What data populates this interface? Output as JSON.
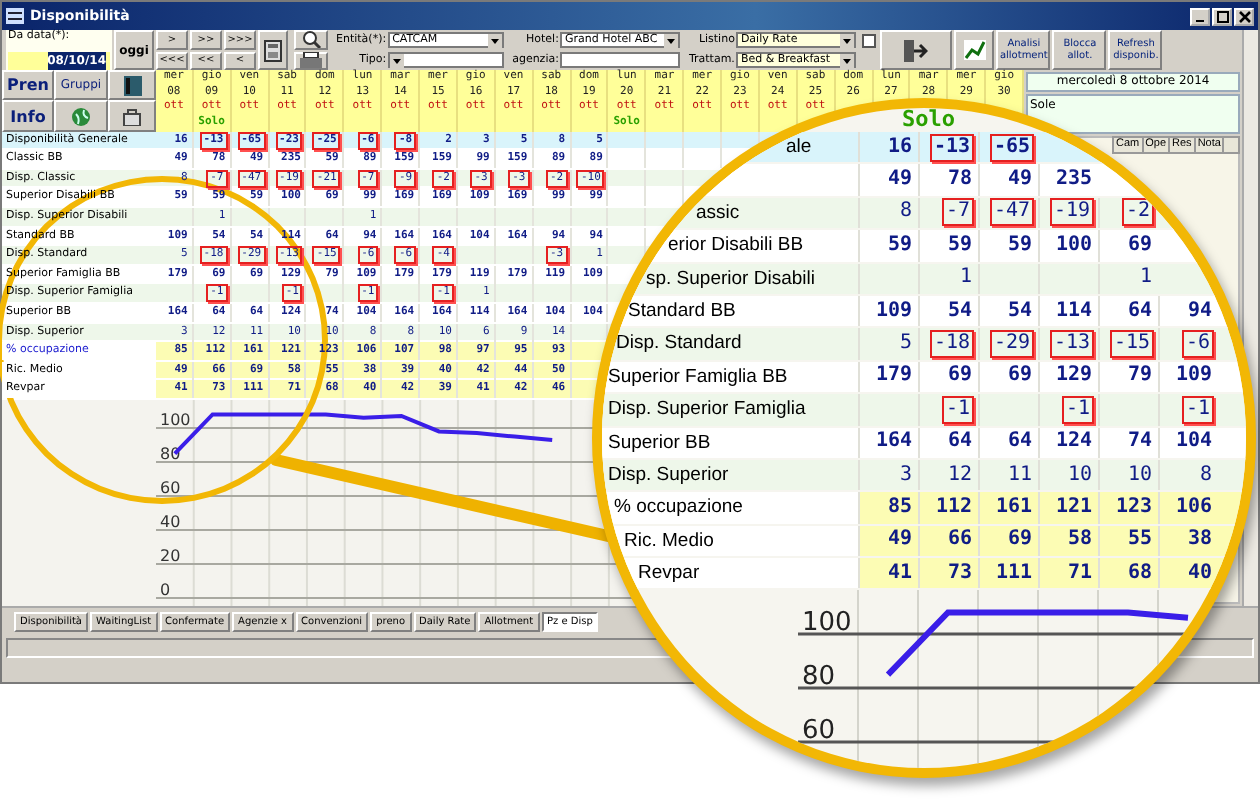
{
  "window": {
    "title": "Disponibilità"
  },
  "toolbar": {
    "date_label": "Da data(*):",
    "date_value": "08/10/14",
    "today_button": "oggi",
    "nav_forward": [
      ">",
      ">>",
      ">>>"
    ],
    "nav_back": [
      "<<<",
      "<<",
      "<"
    ],
    "entity": {
      "label": "Entità(*):",
      "value": "CATCAM"
    },
    "type": {
      "label": "Tipo:"
    },
    "hotel": {
      "label": "Hotel:",
      "value": "Grand Hotel ABC"
    },
    "agency": {
      "label": "agenzia:"
    },
    "price_list": {
      "label": "Listino",
      "value": "Daily Rate"
    },
    "board": {
      "label": "Trattam.",
      "value": "Bed & Breakfast"
    },
    "option_checked": false,
    "buttons": [
      "Analisi allotment",
      "Blocca allot.",
      "Refresh disponib."
    ]
  },
  "side_buttons": [
    {
      "label": "Pren"
    },
    {
      "label": "Gruppi"
    },
    {
      "label": "Info"
    }
  ],
  "dates": [
    {
      "weekday": "mer",
      "day": "08",
      "month": "ott"
    },
    {
      "weekday": "gio",
      "day": "09",
      "month": "ott",
      "note": "Solo"
    },
    {
      "weekday": "ven",
      "day": "10",
      "month": "ott"
    },
    {
      "weekday": "sab",
      "day": "11",
      "month": "ott"
    },
    {
      "weekday": "dom",
      "day": "12",
      "month": "ott"
    },
    {
      "weekday": "lun",
      "day": "13",
      "month": "ott"
    },
    {
      "weekday": "mar",
      "day": "14",
      "month": "ott"
    },
    {
      "weekday": "mer",
      "day": "15",
      "month": "ott"
    },
    {
      "weekday": "gio",
      "day": "16",
      "month": "ott"
    },
    {
      "weekday": "ven",
      "day": "17",
      "month": "ott"
    },
    {
      "weekday": "sab",
      "day": "18",
      "month": "ott"
    },
    {
      "weekday": "dom",
      "day": "19",
      "month": "ott"
    },
    {
      "weekday": "lun",
      "day": "20",
      "month": "ott",
      "note": "Solo"
    },
    {
      "weekday": "mar",
      "day": "21",
      "month": "ott"
    },
    {
      "weekday": "mer",
      "day": "22",
      "month": "ott"
    },
    {
      "weekday": "gio",
      "day": "23",
      "month": "ott"
    },
    {
      "weekday": "ven",
      "day": "24",
      "month": "ott"
    },
    {
      "weekday": "sab",
      "day": "25",
      "month": "ott"
    },
    {
      "weekday": "dom",
      "day": "26"
    },
    {
      "weekday": "lun",
      "day": "27"
    },
    {
      "weekday": "mar",
      "day": "28"
    },
    {
      "weekday": "mer",
      "day": "29"
    },
    {
      "weekday": "gio",
      "day": "30"
    }
  ],
  "rows": [
    {
      "label": "Disponibilità Generale",
      "kind": "total",
      "cells": [
        {
          "value": "16",
          "alert": false
        },
        {
          "value": "-13",
          "alert": true
        },
        {
          "value": "-65",
          "alert": true
        },
        {
          "value": "-23",
          "alert": true
        },
        {
          "value": "-25",
          "alert": true
        },
        {
          "value": "-6",
          "alert": true
        },
        {
          "value": "-8",
          "alert": true
        },
        {
          "value": "2",
          "alert": false
        },
        {
          "value": "3",
          "alert": false
        },
        {
          "value": "5",
          "alert": false
        },
        {
          "value": "8",
          "alert": false
        },
        {
          "value": "5",
          "alert": false
        }
      ]
    },
    {
      "label": "Classic BB",
      "kind": "room",
      "cells": [
        {
          "value": "49",
          "alert": false
        },
        {
          "value": "78",
          "alert": false
        },
        {
          "value": "49",
          "alert": false
        },
        {
          "value": "235",
          "alert": false
        },
        {
          "value": "59",
          "alert": false
        },
        {
          "value": "89",
          "alert": false
        },
        {
          "value": "159",
          "alert": false
        },
        {
          "value": "159",
          "alert": false
        },
        {
          "value": "99",
          "alert": false
        },
        {
          "value": "159",
          "alert": false
        },
        {
          "value": "89",
          "alert": false
        },
        {
          "value": "89",
          "alert": false
        }
      ]
    },
    {
      "label": "Disp.  Classic",
      "kind": "avail",
      "cells": [
        {
          "value": "8",
          "alert": false
        },
        {
          "value": "-7",
          "alert": true
        },
        {
          "value": "-47",
          "alert": true
        },
        {
          "value": "-19",
          "alert": true
        },
        {
          "value": "-21",
          "alert": true
        },
        {
          "value": "-7",
          "alert": true
        },
        {
          "value": "-9",
          "alert": true
        },
        {
          "value": "-2",
          "alert": true
        },
        {
          "value": "-3",
          "alert": true
        },
        {
          "value": "-3",
          "alert": true
        },
        {
          "value": "-2",
          "alert": true
        },
        {
          "value": "-10",
          "alert": true
        }
      ]
    },
    {
      "label": "Superior Disabili BB",
      "kind": "room",
      "cells": [
        {
          "value": "59",
          "alert": false
        },
        {
          "value": "59",
          "alert": false
        },
        {
          "value": "59",
          "alert": false
        },
        {
          "value": "100",
          "alert": false
        },
        {
          "value": "69",
          "alert": false
        },
        {
          "value": "99",
          "alert": false
        },
        {
          "value": "169",
          "alert": false
        },
        {
          "value": "169",
          "alert": false
        },
        {
          "value": "109",
          "alert": false
        },
        {
          "value": "169",
          "alert": false
        },
        {
          "value": "99",
          "alert": false
        },
        {
          "value": "99",
          "alert": false
        }
      ]
    },
    {
      "label": "Disp.  Superior Disabili",
      "kind": "avail",
      "cells": [
        {},
        {
          "value": "1",
          "alert": false
        },
        {},
        {},
        {},
        {
          "value": "1",
          "alert": false
        }
      ]
    },
    {
      "label": "Standard BB",
      "kind": "room",
      "cells": [
        {
          "value": "109",
          "alert": false
        },
        {
          "value": "54",
          "alert": false
        },
        {
          "value": "54",
          "alert": false
        },
        {
          "value": "114",
          "alert": false
        },
        {
          "value": "64",
          "alert": false
        },
        {
          "value": "94",
          "alert": false
        },
        {
          "value": "164",
          "alert": false
        },
        {
          "value": "164",
          "alert": false
        },
        {
          "value": "104",
          "alert": false
        },
        {
          "value": "164",
          "alert": false
        },
        {
          "value": "94",
          "alert": false
        },
        {
          "value": "94",
          "alert": false
        }
      ]
    },
    {
      "label": "Disp.  Standard",
      "kind": "avail",
      "cells": [
        {
          "value": "5",
          "alert": false
        },
        {
          "value": "-18",
          "alert": true
        },
        {
          "value": "-29",
          "alert": true
        },
        {
          "value": "-13",
          "alert": true
        },
        {
          "value": "-15",
          "alert": true
        },
        {
          "value": "-6",
          "alert": true
        },
        {
          "value": "-6",
          "alert": true
        },
        {
          "value": "-4",
          "alert": true
        },
        {},
        {},
        {
          "value": "-3",
          "alert": true
        },
        {
          "value": "1",
          "alert": false
        }
      ]
    },
    {
      "label": "Superior Famiglia BB",
      "kind": "room",
      "cells": [
        {
          "value": "179",
          "alert": false
        },
        {
          "value": "69",
          "alert": false
        },
        {
          "value": "69",
          "alert": false
        },
        {
          "value": "129",
          "alert": false
        },
        {
          "value": "79",
          "alert": false
        },
        {
          "value": "109",
          "alert": false
        },
        {
          "value": "179",
          "alert": false
        },
        {
          "value": "179",
          "alert": false
        },
        {
          "value": "119",
          "alert": false
        },
        {
          "value": "179",
          "alert": false
        },
        {
          "value": "119",
          "alert": false
        },
        {
          "value": "109",
          "alert": false
        }
      ]
    },
    {
      "label": "Disp.  Superior Famiglia",
      "kind": "avail",
      "cells": [
        {},
        {
          "value": "-1",
          "alert": true
        },
        {},
        {
          "value": "-1",
          "alert": true
        },
        {},
        {
          "value": "-1",
          "alert": true
        },
        {},
        {
          "value": "-1",
          "alert": true
        },
        {
          "value": "1",
          "alert": false
        }
      ]
    },
    {
      "label": "Superior BB",
      "kind": "room",
      "cells": [
        {
          "value": "164",
          "alert": false
        },
        {
          "value": "64",
          "alert": false
        },
        {
          "value": "64",
          "alert": false
        },
        {
          "value": "124",
          "alert": false
        },
        {
          "value": "74",
          "alert": false
        },
        {
          "value": "104",
          "alert": false
        },
        {
          "value": "164",
          "alert": false
        },
        {
          "value": "164",
          "alert": false
        },
        {
          "value": "114",
          "alert": false
        },
        {
          "value": "164",
          "alert": false
        },
        {
          "value": "104",
          "alert": false
        },
        {
          "value": "104",
          "alert": false
        }
      ]
    },
    {
      "label": "Disp.  Superior",
      "kind": "avail",
      "cells": [
        {
          "value": "3",
          "alert": false
        },
        {
          "value": "12",
          "alert": false
        },
        {
          "value": "11",
          "alert": false
        },
        {
          "value": "10",
          "alert": false
        },
        {
          "value": "10",
          "alert": false
        },
        {
          "value": "8",
          "alert": false
        },
        {
          "value": "8",
          "alert": false
        },
        {
          "value": "10",
          "alert": false
        },
        {
          "value": "6",
          "alert": false
        },
        {
          "value": "9",
          "alert": false
        },
        {
          "value": "14",
          "alert": false
        }
      ]
    },
    {
      "label": "% occupazione",
      "kind": "percent",
      "cells": [
        {
          "value": "85",
          "alert": false
        },
        {
          "value": "112",
          "alert": false
        },
        {
          "value": "161",
          "alert": false
        },
        {
          "value": "121",
          "alert": false
        },
        {
          "value": "123",
          "alert": false
        },
        {
          "value": "106",
          "alert": false
        },
        {
          "value": "107",
          "alert": false
        },
        {
          "value": "98",
          "alert": false
        },
        {
          "value": "97",
          "alert": false
        },
        {
          "value": "95",
          "alert": false
        },
        {
          "value": "93",
          "alert": false
        }
      ]
    },
    {
      "label": "Ric. Medio",
      "kind": "stat",
      "cells": [
        {
          "value": "49",
          "alert": false
        },
        {
          "value": "66",
          "alert": false
        },
        {
          "value": "69",
          "alert": false
        },
        {
          "value": "58",
          "alert": false
        },
        {
          "value": "55",
          "alert": false
        },
        {
          "value": "38",
          "alert": false
        },
        {
          "value": "39",
          "alert": false
        },
        {
          "value": "40",
          "alert": false
        },
        {
          "value": "42",
          "alert": false
        },
        {
          "value": "44",
          "alert": false
        },
        {
          "value": "50",
          "alert": false
        }
      ]
    },
    {
      "label": "Revpar",
      "kind": "stat",
      "cells": [
        {
          "value": "41",
          "alert": false
        },
        {
          "value": "73",
          "alert": false
        },
        {
          "value": "111",
          "alert": false
        },
        {
          "value": "71",
          "alert": false
        },
        {
          "value": "68",
          "alert": false
        },
        {
          "value": "40",
          "alert": false
        },
        {
          "value": "42",
          "alert": false
        },
        {
          "value": "39",
          "alert": false
        },
        {
          "value": "41",
          "alert": false
        },
        {
          "value": "42",
          "alert": false
        },
        {
          "value": "46",
          "alert": false
        }
      ]
    }
  ],
  "occupancy_chart": {
    "chart_data": {
      "type": "line",
      "categories": [
        null,
        null,
        null,
        null,
        null,
        null,
        null,
        null,
        null,
        null,
        null,
        null,
        null,
        null,
        null,
        null,
        null,
        null,
        null,
        null,
        null,
        null,
        null
      ],
      "series": [
        {
          "color": "#3a1ee8",
          "values": [
            85,
            108,
            108,
            108,
            108,
            106,
            107,
            98,
            97,
            95,
            93,
            null,
            null,
            null,
            null,
            null,
            null,
            null,
            null,
            null,
            null,
            null,
            null
          ]
        }
      ],
      "ylim": [
        0,
        116
      ],
      "yticks": [
        0,
        20,
        40,
        60,
        80,
        100
      ],
      "grid": true
    }
  },
  "detail_panel": {
    "date": "mercoledì 8 ottobre 2014",
    "note": "Sole"
  },
  "tabs": [
    {
      "label": "Disponibilità",
      "selected": false
    },
    {
      "label": "WaitingList",
      "selected": false
    },
    {
      "label": "Confermate",
      "selected": false
    },
    {
      "label": "Agenzie x",
      "selected": false
    },
    {
      "label": "Convenzioni",
      "selected": false
    },
    {
      "label": "preno",
      "selected": false
    },
    {
      "label": "Daily Rate",
      "selected": false
    },
    {
      "label": "Allotment",
      "selected": false
    },
    {
      "label": "Pz e Disp",
      "selected": true
    }
  ],
  "magnifier": {
    "note": "Solo",
    "mini_table_columns": [
      "Cam",
      "Ope",
      "Res",
      "Nota"
    ],
    "rows": [
      {
        "label": "ale",
        "kind": "total",
        "cells": [
          {
            "value": "16",
            "alert": false
          },
          {
            "value": "-13",
            "alert": true
          },
          {
            "value": "-65",
            "alert": true
          }
        ]
      },
      {
        "kind": "room",
        "cells": [
          {
            "value": "49",
            "alert": false
          },
          {
            "value": "78",
            "alert": false
          },
          {
            "value": "49",
            "alert": false
          },
          {
            "value": "235",
            "alert": false
          }
        ]
      },
      {
        "label": "assic",
        "kind": "avail",
        "cells": [
          {
            "value": "8",
            "alert": false
          },
          {
            "value": "-7",
            "alert": true
          },
          {
            "value": "-47",
            "alert": true
          },
          {
            "value": "-19",
            "alert": true
          },
          {
            "value": "-2",
            "alert": true
          }
        ]
      },
      {
        "label": "erior Disabili BB",
        "kind": "room",
        "cells": [
          {
            "value": "59",
            "alert": false
          },
          {
            "value": "59",
            "alert": false
          },
          {
            "value": "59",
            "alert": false
          },
          {
            "value": "100",
            "alert": false
          },
          {
            "value": "69",
            "alert": false
          }
        ]
      },
      {
        "label": "sp.  Superior Disabili",
        "kind": "avail",
        "cells": [
          {},
          {
            "value": "1",
            "alert": false
          },
          {},
          {},
          {
            "value": "1",
            "alert": false
          }
        ]
      },
      {
        "label": "Standard BB",
        "kind": "room",
        "cells": [
          {
            "value": "109",
            "alert": false
          },
          {
            "value": "54",
            "alert": false
          },
          {
            "value": "54",
            "alert": false
          },
          {
            "value": "114",
            "alert": false
          },
          {
            "value": "64",
            "alert": false
          },
          {
            "value": "94",
            "alert": false
          }
        ]
      },
      {
        "label": "Disp.  Standard",
        "kind": "avail",
        "cells": [
          {
            "value": "5",
            "alert": false
          },
          {
            "value": "-18",
            "alert": true
          },
          {
            "value": "-29",
            "alert": true
          },
          {
            "value": "-13",
            "alert": true
          },
          {
            "value": "-15",
            "alert": true
          },
          {
            "value": "-6",
            "alert": true
          }
        ]
      },
      {
        "label": "Superior Famiglia BB",
        "kind": "room",
        "cells": [
          {
            "value": "179",
            "alert": false
          },
          {
            "value": "69",
            "alert": false
          },
          {
            "value": "69",
            "alert": false
          },
          {
            "value": "129",
            "alert": false
          },
          {
            "value": "79",
            "alert": false
          },
          {
            "value": "109",
            "alert": false
          }
        ]
      },
      {
        "label": "Disp.  Superior Famiglia",
        "kind": "avail",
        "cells": [
          {},
          {
            "value": "-1",
            "alert": true
          },
          {},
          {
            "value": "-1",
            "alert": true
          },
          {},
          {
            "value": "-1",
            "alert": true
          }
        ]
      },
      {
        "label": "Superior BB",
        "kind": "room",
        "cells": [
          {
            "value": "164",
            "alert": false
          },
          {
            "value": "64",
            "alert": false
          },
          {
            "value": "64",
            "alert": false
          },
          {
            "value": "124",
            "alert": false
          },
          {
            "value": "74",
            "alert": false
          },
          {
            "value": "104",
            "alert": false
          }
        ]
      },
      {
        "label": "Disp.  Superior",
        "kind": "avail",
        "cells": [
          {
            "value": "3",
            "alert": false
          },
          {
            "value": "12",
            "alert": false
          },
          {
            "value": "11",
            "alert": false
          },
          {
            "value": "10",
            "alert": false
          },
          {
            "value": "10",
            "alert": false
          },
          {
            "value": "8",
            "alert": false
          }
        ]
      },
      {
        "label": "% occupazione",
        "kind": "percent",
        "cells": [
          {
            "value": "85",
            "alert": false
          },
          {
            "value": "112",
            "alert": false
          },
          {
            "value": "161",
            "alert": false
          },
          {
            "value": "121",
            "alert": false
          },
          {
            "value": "123",
            "alert": false
          },
          {
            "value": "106",
            "alert": false
          }
        ]
      },
      {
        "label": "Ric. Medio",
        "kind": "stat",
        "cells": [
          {
            "value": "49",
            "alert": false
          },
          {
            "value": "66",
            "alert": false
          },
          {
            "value": "69",
            "alert": false
          },
          {
            "value": "58",
            "alert": false
          },
          {
            "value": "55",
            "alert": false
          },
          {
            "value": "38",
            "alert": false
          }
        ]
      },
      {
        "label": "Revpar",
        "kind": "stat",
        "cells": [
          {
            "value": "41",
            "alert": false
          },
          {
            "value": "73",
            "alert": false
          },
          {
            "value": "111",
            "alert": false
          },
          {
            "value": "71",
            "alert": false
          },
          {
            "value": "68",
            "alert": false
          },
          {
            "value": "40",
            "alert": false
          }
        ]
      }
    ],
    "axis_labels": [
      "100",
      "80",
      "60"
    ]
  }
}
